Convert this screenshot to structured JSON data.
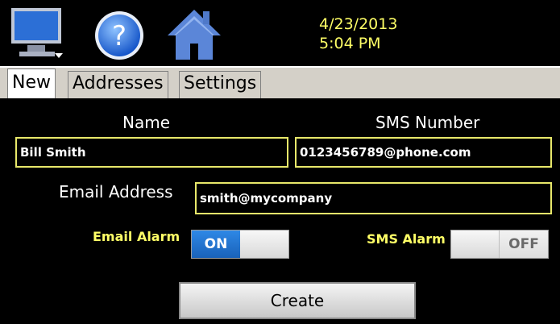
{
  "toolbar": {
    "datetime": {
      "date": "4/23/2013",
      "time": "5:04 PM"
    }
  },
  "tabs": [
    {
      "label": "New",
      "active": true
    },
    {
      "label": "Addresses",
      "active": false
    },
    {
      "label": "Settings",
      "active": false
    }
  ],
  "form": {
    "name_label": "Name",
    "name_value": "Bill Smith",
    "sms_label": "SMS Number",
    "sms_value": "0123456789@phone.com",
    "email_label": "Email Address",
    "email_value": "smith@mycompany",
    "email_alarm_label": "Email Alarm",
    "email_alarm_state": "ON",
    "sms_alarm_label": "SMS Alarm",
    "sms_alarm_state": "OFF",
    "create_label": "Create"
  },
  "colors": {
    "accent_blue": "#1f6fd0",
    "field_border": "#e8e86a",
    "alarm_label": "#ffff66"
  }
}
